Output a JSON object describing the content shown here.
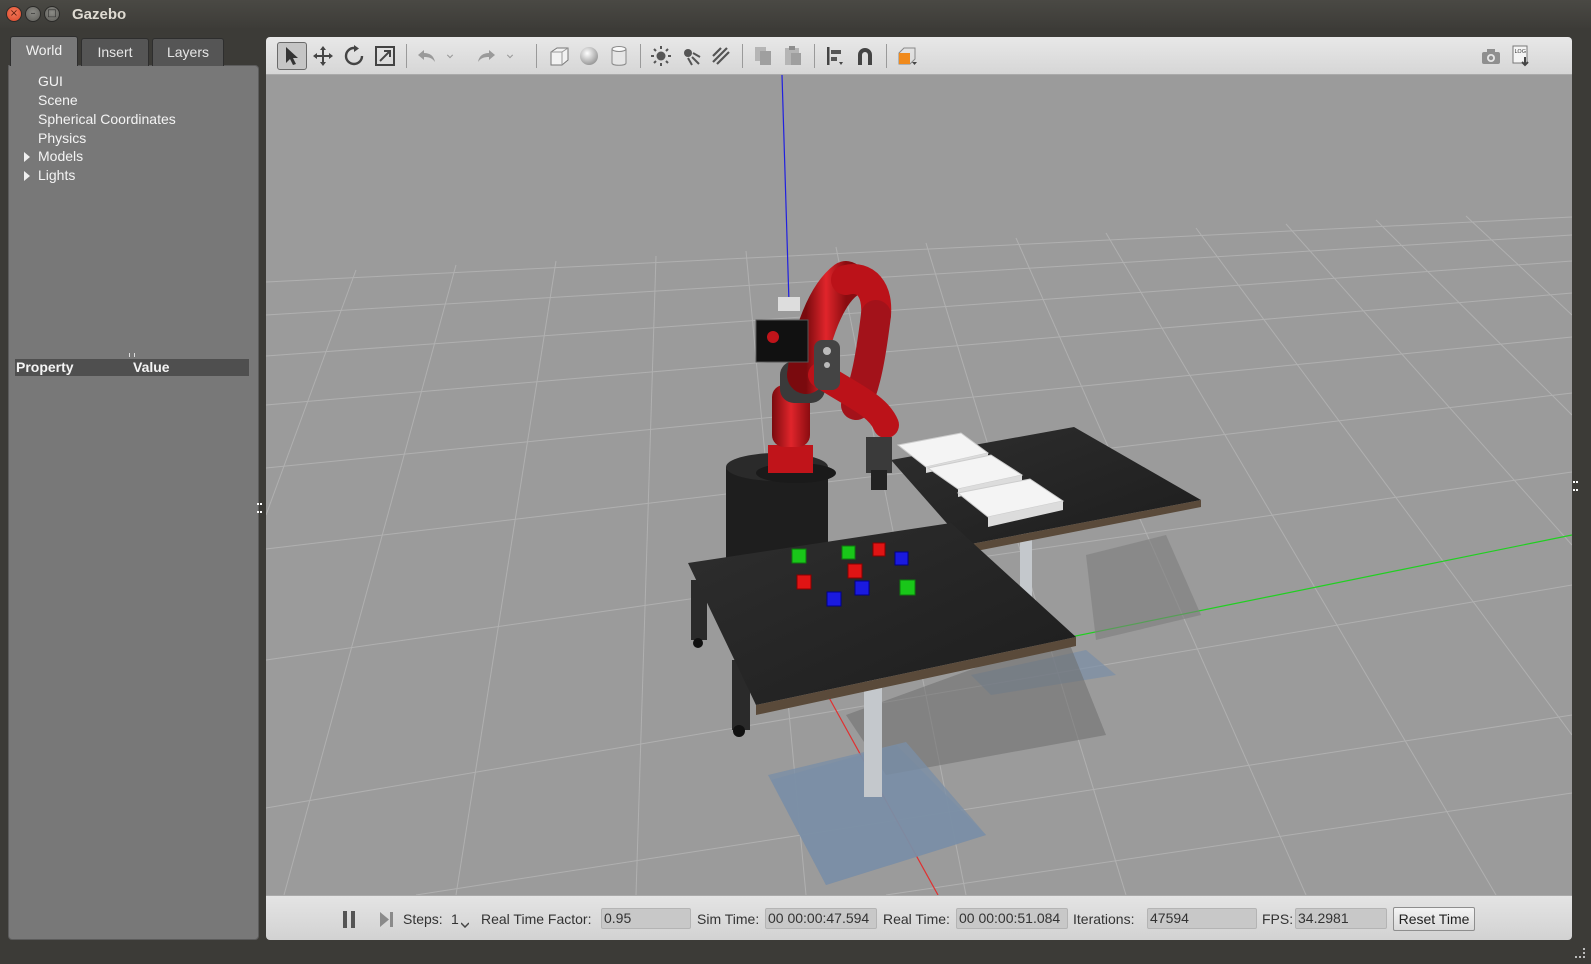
{
  "window": {
    "title": "Gazebo",
    "close_glyph": "×",
    "min_glyph": "–",
    "max_glyph": "□"
  },
  "left_panel": {
    "tabs": [
      {
        "label": "World",
        "active": true
      },
      {
        "label": "Insert",
        "active": false
      },
      {
        "label": "Layers",
        "active": false
      }
    ],
    "tree": [
      {
        "label": "GUI",
        "expandable": false
      },
      {
        "label": "Scene",
        "expandable": false
      },
      {
        "label": "Spherical Coordinates",
        "expandable": false
      },
      {
        "label": "Physics",
        "expandable": false
      },
      {
        "label": "Models",
        "expandable": true
      },
      {
        "label": "Lights",
        "expandable": true
      }
    ],
    "property_table": {
      "col_property": "Property",
      "col_value": "Value"
    }
  },
  "toolbar": {
    "tools": [
      {
        "name": "select-mode",
        "icon": "arrow-cursor-icon",
        "active": true
      },
      {
        "name": "translate-mode",
        "icon": "move-arrows-icon"
      },
      {
        "name": "rotate-mode",
        "icon": "rotate-icon"
      },
      {
        "name": "scale-mode",
        "icon": "scale-icon"
      },
      {
        "name": "undo",
        "icon": "undo-icon"
      },
      {
        "name": "redo",
        "icon": "redo-icon"
      },
      {
        "name": "box-shape",
        "icon": "box-icon"
      },
      {
        "name": "sphere-shape",
        "icon": "sphere-icon"
      },
      {
        "name": "cylinder-shape",
        "icon": "cylinder-icon"
      },
      {
        "name": "point-light",
        "icon": "point-light-icon"
      },
      {
        "name": "spot-light",
        "icon": "spot-light-icon"
      },
      {
        "name": "directional-light",
        "icon": "directional-light-icon"
      },
      {
        "name": "copy",
        "icon": "copy-icon"
      },
      {
        "name": "paste",
        "icon": "paste-icon"
      },
      {
        "name": "align",
        "icon": "align-icon"
      },
      {
        "name": "snap",
        "icon": "magnet-icon"
      },
      {
        "name": "view-angle",
        "icon": "view-cube-icon"
      },
      {
        "name": "screenshot",
        "icon": "camera-icon"
      },
      {
        "name": "log",
        "icon": "log-icon"
      }
    ],
    "log_badge": "LOG"
  },
  "bottom_bar": {
    "steps_label": "Steps:",
    "steps_value": "1",
    "rtf_label": "Real Time Factor:",
    "rtf_value": "0.95",
    "sim_time_label": "Sim Time:",
    "sim_time_value": "00 00:00:47.594",
    "real_time_label": "Real Time:",
    "real_time_value": "00 00:00:51.084",
    "iterations_label": "Iterations:",
    "iterations_value": "47594",
    "fps_label": "FPS:",
    "fps_value": "34.2981",
    "reset_label": "Reset Time"
  },
  "scene": {
    "background_color": "#9b9b9b",
    "grid_color": "#b2b2b2",
    "robot_color": "#c0141a",
    "table_color": "#262626",
    "cube_colors": [
      "#19c719",
      "#e01414",
      "#1a1ae0"
    ],
    "z_axis_color": "#2020e0",
    "y_axis_color": "#20d020",
    "x_axis_color": "#e03030"
  }
}
